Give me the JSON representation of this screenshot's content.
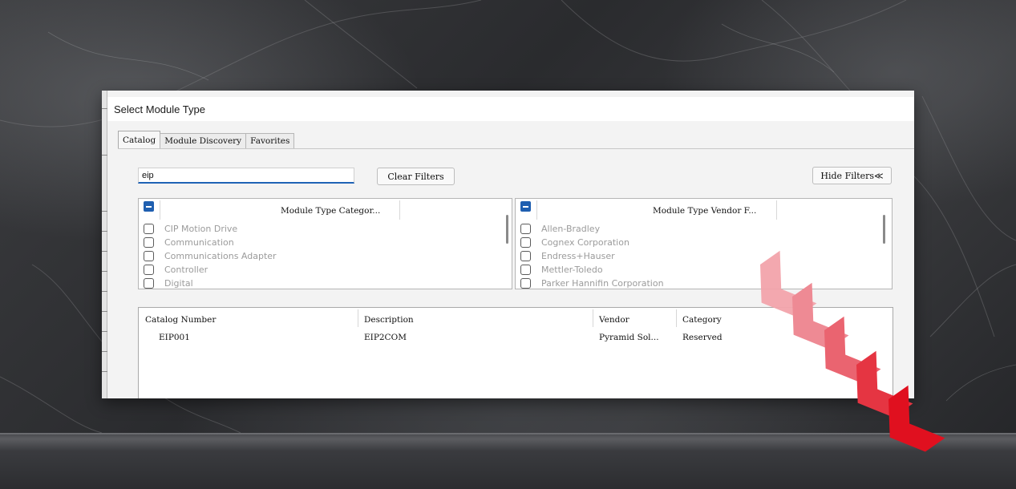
{
  "window": {
    "title": "Select Module Type"
  },
  "tabs": [
    {
      "label": "Catalog",
      "active": true
    },
    {
      "label": "Module Discovery",
      "active": false
    },
    {
      "label": "Favorites",
      "active": false
    }
  ],
  "search": {
    "value": "eip"
  },
  "buttons": {
    "clear_filters": "Clear Filters",
    "hide_filters": "Hide Filters≪"
  },
  "category_filter": {
    "header": "Module Type Categor...",
    "items": [
      {
        "label": "CIP Motion Drive",
        "checked": false
      },
      {
        "label": "Communication",
        "checked": false
      },
      {
        "label": "Communications Adapter",
        "checked": false
      },
      {
        "label": "Controller",
        "checked": false
      },
      {
        "label": "Digital",
        "checked": false
      }
    ]
  },
  "vendor_filter": {
    "header": "Module Type Vendor F...",
    "items": [
      {
        "label": "Allen-Bradley",
        "checked": false
      },
      {
        "label": "Cognex Corporation",
        "checked": false
      },
      {
        "label": "Endress+Hauser",
        "checked": false
      },
      {
        "label": "Mettler-Toledo",
        "checked": false
      },
      {
        "label": "Parker Hannifin Corporation",
        "checked": false
      }
    ]
  },
  "results": {
    "columns": [
      "Catalog Number",
      "Description",
      "Vendor",
      "Category"
    ],
    "rows": [
      [
        "EIP001",
        "EIP2COM",
        "Pyramid Sol...",
        "Reserved"
      ]
    ]
  },
  "colors": {
    "accent": "#1f5fb0",
    "chevron_red": "#e0101f",
    "chevron_pink": "#f2a3ab"
  },
  "icons": {
    "header_check": "minus-checkbox-icon",
    "hide_filters": "double-chevron-up-icon",
    "decoration": "red-chevron-arrows"
  }
}
